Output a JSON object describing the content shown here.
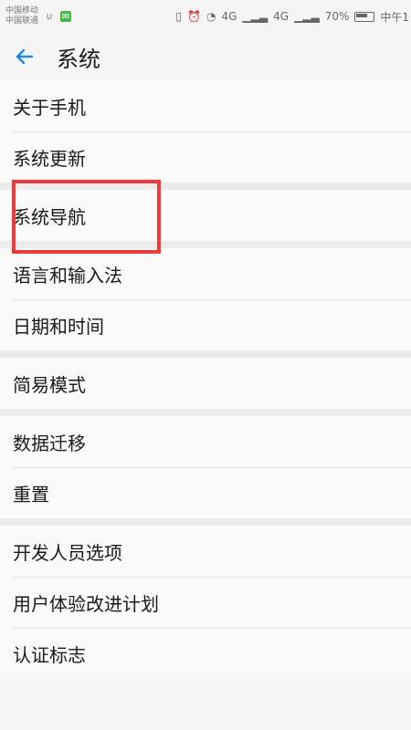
{
  "status_bar": {
    "carrier_1": "中国移动",
    "carrier_2": "中国联通",
    "left_icons": [
      "link-icon",
      "message-icon"
    ],
    "network_labels": [
      "4G",
      "4G"
    ],
    "battery": "70%",
    "time": "中午1"
  },
  "header": {
    "back_icon": "arrow-left-icon",
    "title": "系统"
  },
  "settings": {
    "group_1": [
      "关于手机",
      "系统更新"
    ],
    "group_2": [
      "系统导航"
    ],
    "group_3": [
      "语言和输入法",
      "日期和时间"
    ],
    "group_4": [
      "简易模式"
    ],
    "group_5": [
      "数据迁移",
      "重置"
    ],
    "group_6": [
      "开发人员选项",
      "用户体验改进计划",
      "认证标志"
    ]
  },
  "colors": {
    "accent": "#1e88e5",
    "highlight": "#ee3a3a",
    "background": "#f5f5f5"
  }
}
